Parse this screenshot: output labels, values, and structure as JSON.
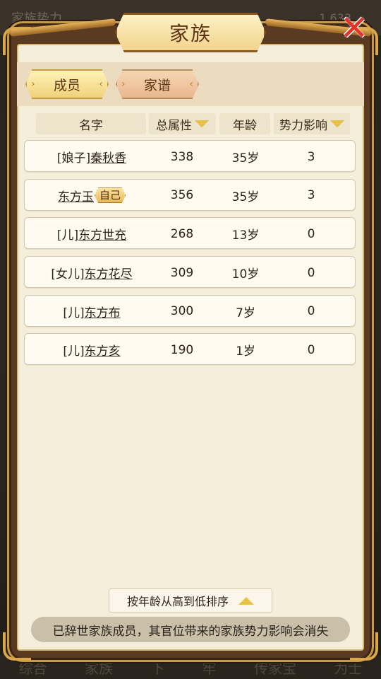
{
  "background": {
    "title": "家族势力",
    "currency": "1 633",
    "bottom_nav": [
      "综合",
      "家族",
      "下",
      "牢",
      "传家宝",
      "为士"
    ]
  },
  "dialog": {
    "title": "家族",
    "close_icon": "close-x-icon",
    "tabs": [
      {
        "label": "成员",
        "active": true
      },
      {
        "label": "家谱",
        "active": false
      }
    ],
    "columns": {
      "name": "名字",
      "attr": "总属性",
      "age": "年龄",
      "influence": "势力影响"
    },
    "members": [
      {
        "prefix": "[娘子]",
        "name": "秦秋香",
        "self": "",
        "attr": "338",
        "age": "35岁",
        "influence": "3"
      },
      {
        "prefix": "",
        "name": "东方玉",
        "self": "自己",
        "attr": "356",
        "age": "35岁",
        "influence": "3"
      },
      {
        "prefix": "[儿]",
        "name": "东方世充",
        "self": "",
        "attr": "268",
        "age": "13岁",
        "influence": "0"
      },
      {
        "prefix": "[女儿]",
        "name": "东方花尽",
        "self": "",
        "attr": "309",
        "age": "10岁",
        "influence": "0"
      },
      {
        "prefix": "[儿]",
        "name": "东方布",
        "self": "",
        "attr": "300",
        "age": "7岁",
        "influence": "0"
      },
      {
        "prefix": "[儿]",
        "name": "东方亥",
        "self": "",
        "attr": "190",
        "age": "1岁",
        "influence": "0"
      }
    ],
    "sort_label": "按年龄从高到低排序",
    "notice": "已辞世家族成员，其官位带来的家族势力影响会消失"
  }
}
